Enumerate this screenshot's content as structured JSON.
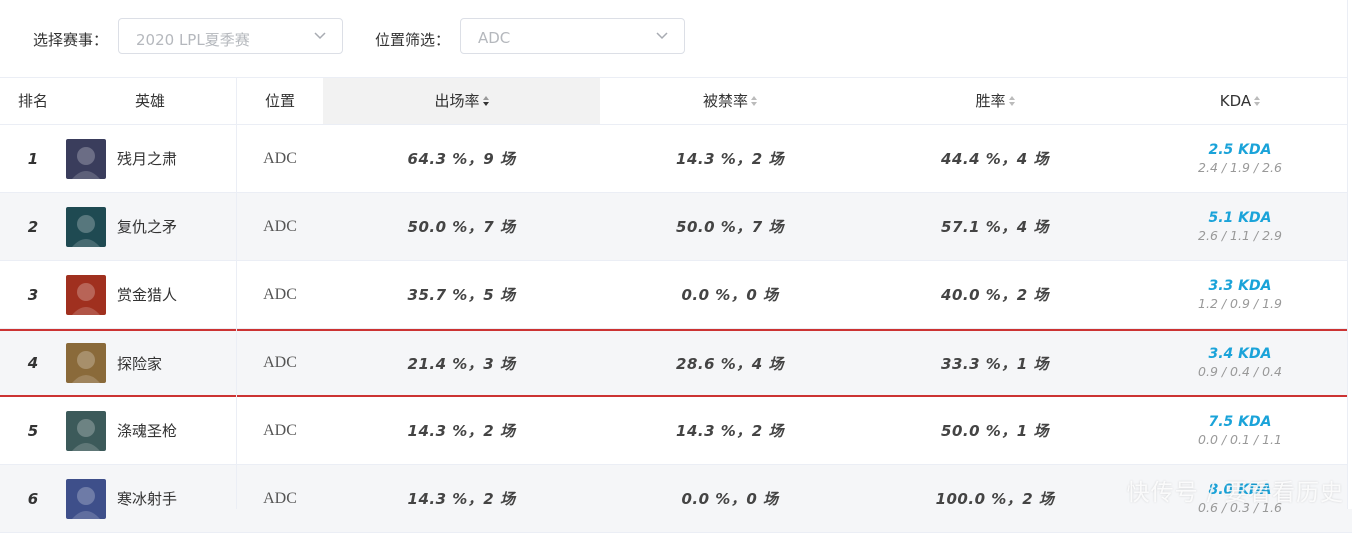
{
  "filters": {
    "event_label": "选择赛事：",
    "event_value": "2020 LPL夏季赛",
    "position_label": "位置筛选：",
    "position_value": "ADC"
  },
  "table": {
    "headers": {
      "rank": "排名",
      "hero": "英雄",
      "position": "位置",
      "pick_rate": "出场率",
      "ban_rate": "被禁率",
      "win_rate": "胜率",
      "kda": "KDA"
    },
    "rows": [
      {
        "rank": "1",
        "hero": "残月之肃",
        "position": "ADC",
        "pick": "64.3 %，",
        "pick_games": "9 场",
        "ban": "14.3 %，",
        "ban_games": "2 场",
        "win": "44.4 %，",
        "win_games": "4 场",
        "kda": "2.5 KDA",
        "kda_detail": "2.4 / 1.9 / 2.6",
        "avatar_color": "#3a3d5c"
      },
      {
        "rank": "2",
        "hero": "复仇之矛",
        "position": "ADC",
        "pick": "50.0 %，",
        "pick_games": "7 场",
        "ban": "50.0 %，",
        "ban_games": "7 场",
        "win": "57.1 %，",
        "win_games": "4 场",
        "kda": "5.1 KDA",
        "kda_detail": "2.6 / 1.1 / 2.9",
        "avatar_color": "#1f4a52"
      },
      {
        "rank": "3",
        "hero": "赏金猎人",
        "position": "ADC",
        "pick": "35.7 %，",
        "pick_games": "5 场",
        "ban": "0.0 %，",
        "ban_games": "0 场",
        "win": "40.0 %，",
        "win_games": "2 场",
        "kda": "3.3 KDA",
        "kda_detail": "1.2 / 0.9 / 1.9",
        "avatar_color": "#a0301f"
      },
      {
        "rank": "4",
        "hero": "探险家",
        "position": "ADC",
        "pick": "21.4 %，",
        "pick_games": "3 场",
        "ban": "28.6 %，",
        "ban_games": "4 场",
        "win": "33.3 %，",
        "win_games": "1 场",
        "kda": "3.4 KDA",
        "kda_detail": "0.9 / 0.4 / 0.4",
        "avatar_color": "#8a6a3a"
      },
      {
        "rank": "5",
        "hero": "涤魂圣枪",
        "position": "ADC",
        "pick": "14.3 %，",
        "pick_games": "2 场",
        "ban": "14.3 %，",
        "ban_games": "2 场",
        "win": "50.0 %，",
        "win_games": "1 场",
        "kda": "7.5 KDA",
        "kda_detail": "0.0 / 0.1 / 1.1",
        "avatar_color": "#3c5a5a"
      },
      {
        "rank": "6",
        "hero": "寒冰射手",
        "position": "ADC",
        "pick": "14.3 %，",
        "pick_games": "2 场",
        "ban": "0.0 %，",
        "ban_games": "0 场",
        "win": "100.0 %，",
        "win_games": "2 场",
        "kda": "8.0 KDA",
        "kda_detail": "0.6 / 0.3 / 1.6",
        "avatar_color": "#3e4f8a"
      }
    ]
  },
  "watermark": "快传号 / 要看看历史"
}
